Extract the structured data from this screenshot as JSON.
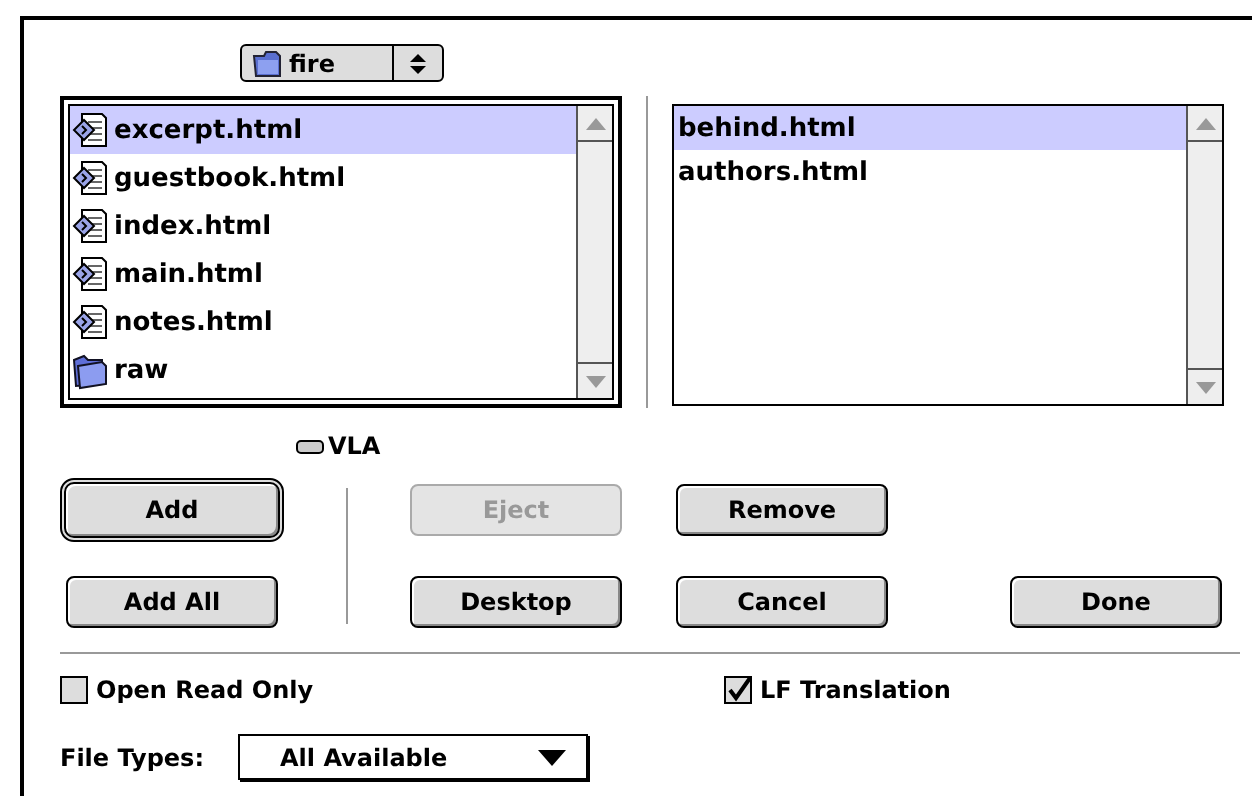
{
  "folder_popup": {
    "label": "fire"
  },
  "source_list": {
    "items": [
      {
        "name": "excerpt.html",
        "kind": "file",
        "selected": true
      },
      {
        "name": "guestbook.html",
        "kind": "file",
        "selected": false
      },
      {
        "name": "index.html",
        "kind": "file",
        "selected": false
      },
      {
        "name": "main.html",
        "kind": "file",
        "selected": false
      },
      {
        "name": "notes.html",
        "kind": "file",
        "selected": false
      },
      {
        "name": "raw",
        "kind": "folder",
        "selected": false
      }
    ]
  },
  "chosen_list": {
    "items": [
      {
        "name": "behind.html",
        "selected": true
      },
      {
        "name": "authors.html",
        "selected": false
      }
    ]
  },
  "volume": {
    "label": "VLA"
  },
  "buttons": [
    {
      "label": "Add",
      "default": true,
      "disabled": false
    },
    {
      "label": "Eject",
      "default": false,
      "disabled": true
    },
    {
      "label": "Remove",
      "default": false,
      "disabled": false
    },
    {
      "label": "Add All",
      "default": false,
      "disabled": false
    },
    {
      "label": "Desktop",
      "default": false,
      "disabled": false
    },
    {
      "label": "Cancel",
      "default": false,
      "disabled": false
    },
    {
      "label": "Done",
      "default": false,
      "disabled": false
    }
  ],
  "options": [
    {
      "label": "Open Read Only",
      "checked": false
    },
    {
      "label": "LF Translation",
      "checked": true
    }
  ],
  "file_types": {
    "label": "File Types:",
    "value": "All Available"
  }
}
